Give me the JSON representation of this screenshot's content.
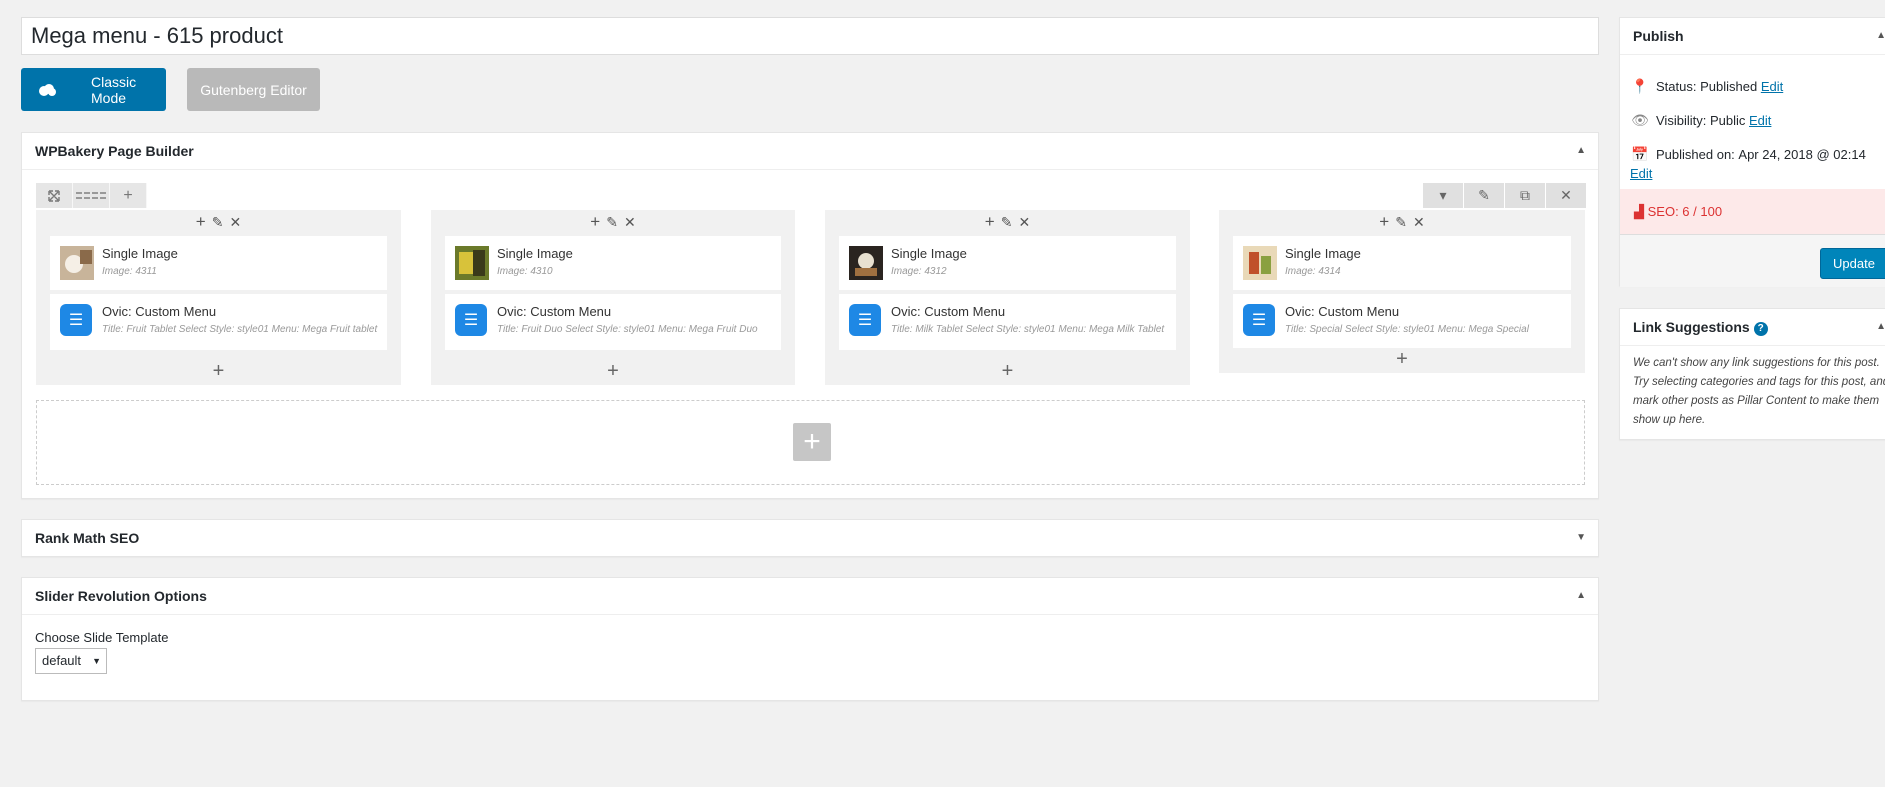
{
  "post_title": "Mega menu - 615 product",
  "editor_modes": {
    "classic": "Classic Mode",
    "gutenberg": "Gutenberg Editor"
  },
  "wpbakery": {
    "title": "WPBakery Page Builder",
    "columns": [
      {
        "image_title": "Single Image",
        "image_sub": "Image: 4311",
        "menu_title": "Ovic: Custom Menu",
        "menu_sub": "Title: Fruit Tablet  Select Style: style01  Menu: Mega Fruit tablet"
      },
      {
        "image_title": "Single Image",
        "image_sub": "Image: 4310",
        "menu_title": "Ovic: Custom Menu",
        "menu_sub": "Title: Fruit Duo  Select Style: style01  Menu: Mega Fruit Duo"
      },
      {
        "image_title": "Single Image",
        "image_sub": "Image: 4312",
        "menu_title": "Ovic: Custom Menu",
        "menu_sub": "Title: Milk Tablet  Select Style: style01  Menu: Mega Milk Tablet"
      },
      {
        "image_title": "Single Image",
        "image_sub": "Image: 4314",
        "menu_title": "Ovic: Custom Menu",
        "menu_sub": "Title: Special  Select Style: style01  Menu: Mega Special"
      }
    ]
  },
  "rankmath": {
    "title": "Rank Math SEO"
  },
  "slider": {
    "title": "Slider Revolution Options",
    "label": "Choose Slide Template",
    "value": "default"
  },
  "publish": {
    "title": "Publish",
    "status_label": "Status:",
    "status_value": "Published",
    "visibility_label": "Visibility:",
    "visibility_value": "Public",
    "published_on_label": "Published on:",
    "published_on_value": "Apr 24, 2018 @ 02:14",
    "edit": "Edit",
    "seo": "SEO: 6 / 100",
    "update": "Update"
  },
  "link_suggestions": {
    "title": "Link Suggestions",
    "help": "?",
    "text": "We can't show any link suggestions for this post. Try selecting categories and tags for this post, and mark other posts as Pillar Content to make them show up here."
  },
  "colors": {
    "accent": "#0073aa",
    "seo_bad": "#dc3232",
    "menu_icon": "#1e88e5"
  }
}
